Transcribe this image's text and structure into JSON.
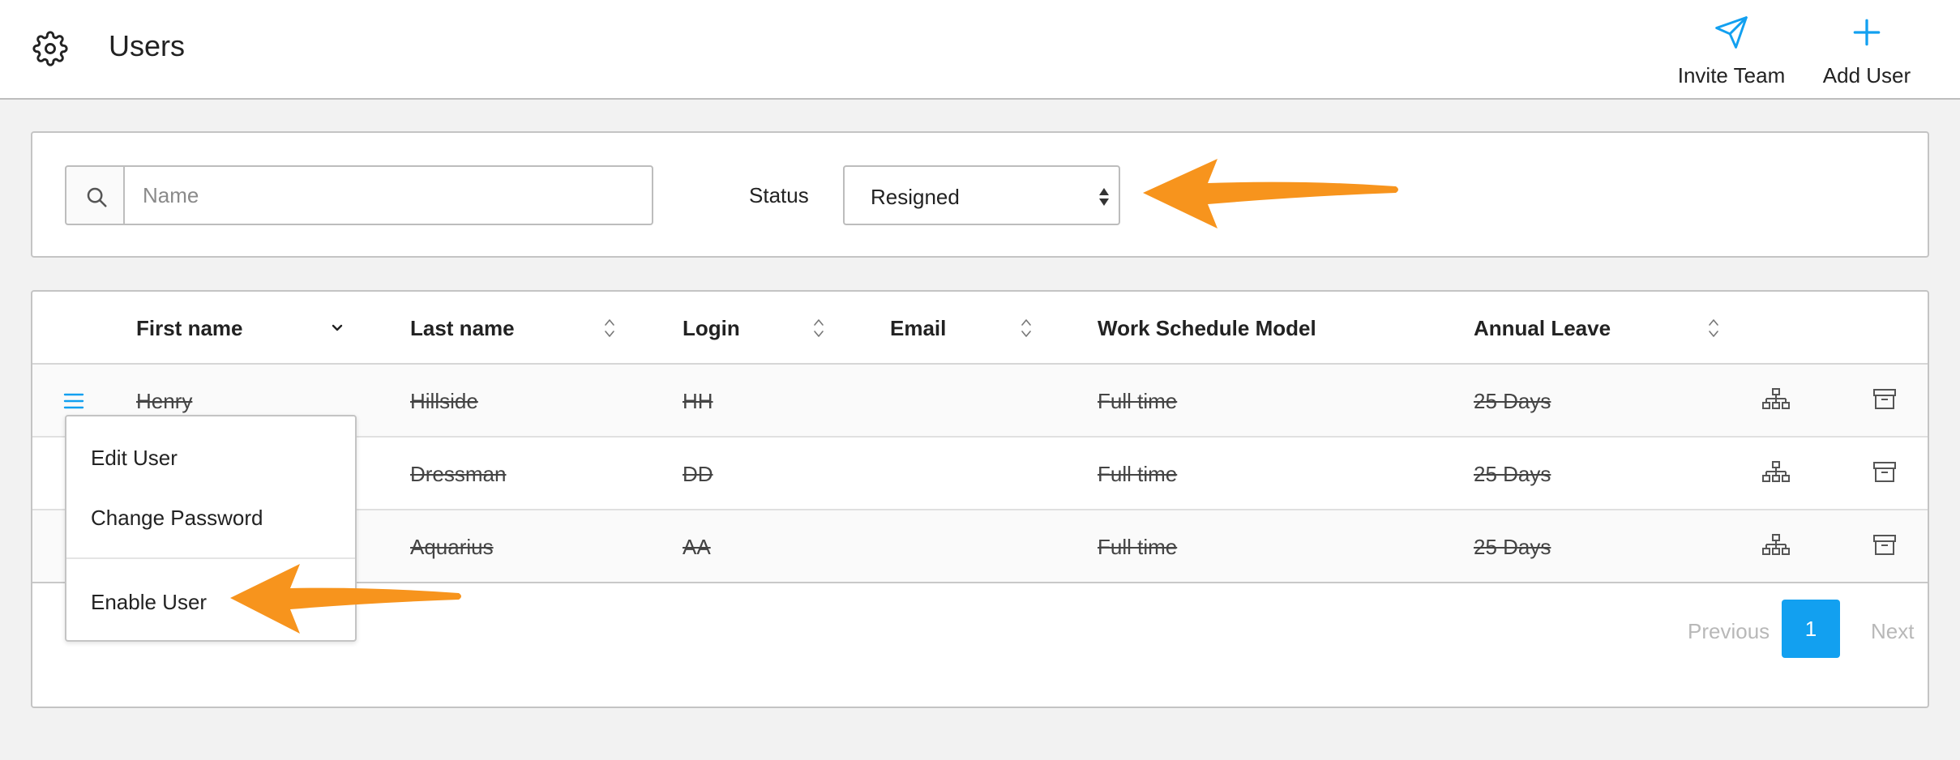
{
  "header": {
    "title": "Users",
    "settings_icon": "gear-icon",
    "actions": {
      "invite_team": {
        "label": "Invite Team",
        "icon": "paper-plane-icon"
      },
      "add_user": {
        "label": "Add User",
        "icon": "plus-icon"
      }
    }
  },
  "filters": {
    "search": {
      "placeholder": "Name",
      "value": ""
    },
    "status": {
      "label": "Status",
      "selected": "Resigned"
    }
  },
  "table": {
    "columns": {
      "first_name": "First name",
      "last_name": "Last name",
      "login": "Login",
      "email": "Email",
      "work_schedule": "Work Schedule Model",
      "annual_leave": "Annual Leave"
    },
    "rows": [
      {
        "first_name": "Henry",
        "last_name": "Hillside",
        "login": "HH",
        "email": "",
        "work_schedule": "Full time",
        "annual_leave": "25 Days"
      },
      {
        "first_name": "",
        "last_name": "Dressman",
        "login": "DD",
        "email": "",
        "work_schedule": "Full time",
        "annual_leave": "25 Days"
      },
      {
        "first_name": "",
        "last_name": "Aquarius",
        "login": "AA",
        "email": "",
        "work_schedule": "Full time",
        "annual_leave": "25 Days"
      }
    ]
  },
  "context_menu": {
    "items": {
      "edit_user": "Edit User",
      "change_password": "Change Password",
      "enable_user": "Enable User"
    }
  },
  "pagination": {
    "previous": "Previous",
    "current_page": "1",
    "next": "Next"
  },
  "colors": {
    "accent": "#12a0f0",
    "annotation_arrow": "#f7941d"
  }
}
